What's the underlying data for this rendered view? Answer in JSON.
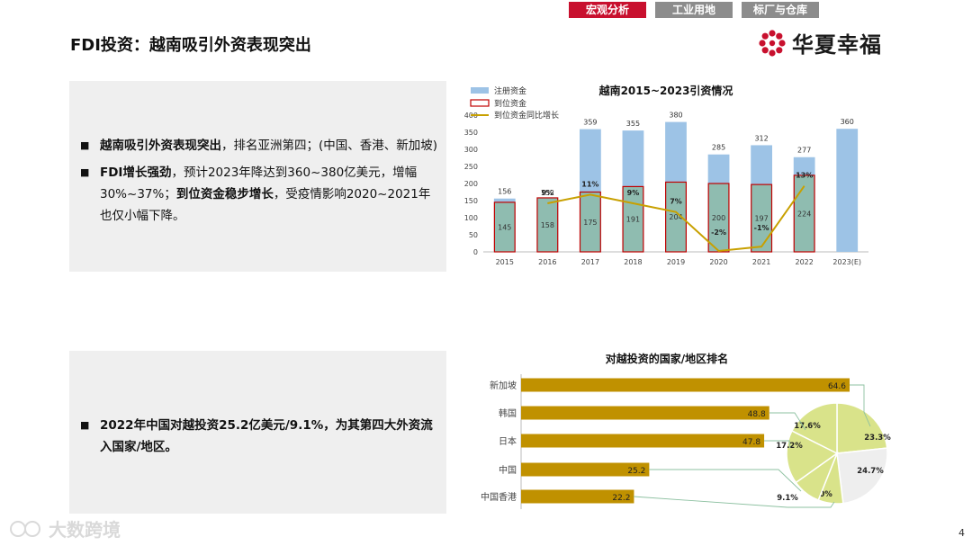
{
  "nav": {
    "tabs": [
      "宏观分析",
      "工业用地",
      "标厂与仓库"
    ]
  },
  "page": {
    "title": "FDI投资：越南吸引外资表现突出",
    "number": "4"
  },
  "logo": {
    "text": "华夏幸福"
  },
  "watermark": {
    "text": "大数跨境"
  },
  "section1": {
    "b1_bold": "越南吸引外资表现突出",
    "b1_rest": "，排名亚洲第四；(中国、香港、新加坡)",
    "b2_bold1": "FDI增长强劲",
    "b2_text1": "，预计2023年降达到360~380亿美元，增幅30%~37%；",
    "b2_bold2": "到位资金稳步增长",
    "b2_text2": "，受疫情影响2020~2021年也仅小幅下降。"
  },
  "section2": {
    "b1_bold": "2022年中国对越投资25.2亿美元/9.1%，为其第四大外资流入国家/地区。"
  },
  "colors": {
    "registered": "#9dc3e6",
    "arrived_fill": "#8fbcb0",
    "arrived_border": "#c00000",
    "growth_line": "#c8a000",
    "hbar": "#c09100",
    "pie_light": "#d9e38a",
    "pie_grey": "#eeeeee",
    "accent": "#c8102e"
  },
  "chart_data": [
    {
      "type": "bar",
      "title": "越南2015~2023引资情况",
      "categories": [
        "2015",
        "2016",
        "2017",
        "2018",
        "2019",
        "2020",
        "2021",
        "2022",
        "2023(E)"
      ],
      "ylim": [
        0,
        400
      ],
      "yticks": [
        0,
        50,
        100,
        150,
        200,
        250,
        300,
        350,
        400
      ],
      "legend": "top-left",
      "series": [
        {
          "name": "注册资金",
          "values": [
            156,
            152,
            359,
            355,
            380,
            285,
            312,
            277,
            360
          ]
        },
        {
          "name": "到位资金",
          "values": [
            145,
            158,
            175,
            191,
            204,
            200,
            197,
            224,
            null
          ]
        },
        {
          "name": "到位资金同比增长",
          "type": "line",
          "values": [
            null,
            9,
            11,
            9,
            7,
            -2,
            -1,
            13,
            null
          ],
          "labels": [
            "",
            "9%",
            "11%",
            "9%",
            "7%",
            "-2%",
            "-1%",
            "13%",
            ""
          ]
        }
      ]
    },
    {
      "type": "bar",
      "orientation": "horizontal",
      "title": "对越投资的国家/地区排名",
      "categories": [
        "新加坡",
        "韩国",
        "日本",
        "中国",
        "中国香港"
      ],
      "values": [
        64.6,
        48.8,
        47.8,
        25.2,
        22.2
      ],
      "pie": {
        "values": [
          23.3,
          24.7,
          8.0,
          9.1,
          17.2,
          17.6
        ],
        "labels": [
          "23.3%",
          "24.7%",
          "8.0%",
          "9.1%",
          "17.2%",
          "17.6%"
        ]
      }
    }
  ]
}
